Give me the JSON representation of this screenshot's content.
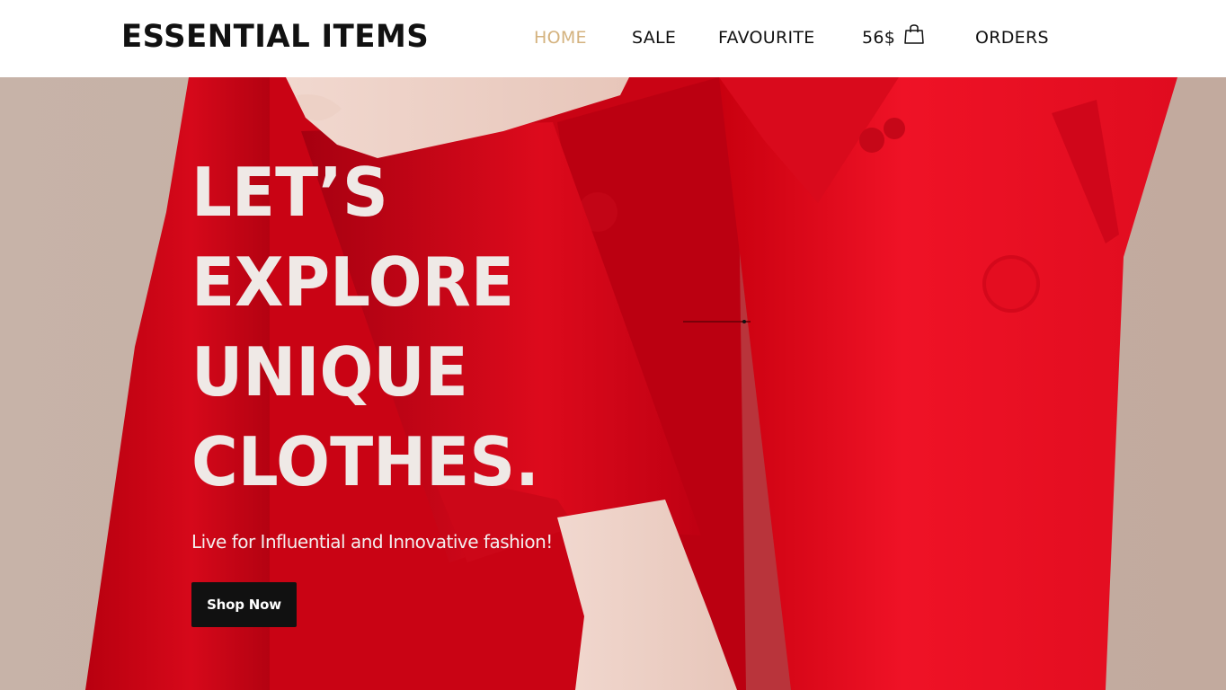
{
  "header": {
    "brand": "ESSENTIAL ITEMS",
    "nav": {
      "home": "HOME",
      "sale": "SALE",
      "favourite": "FAVOURITE",
      "cart_total": "56$",
      "orders": "ORDERS"
    },
    "cart_icon": "shopping-bag-icon",
    "active_color": "#d4b27e"
  },
  "hero": {
    "heading_lines": [
      "LET’S",
      "EXPLORE",
      "UNIQUE",
      "CLOTHES."
    ],
    "subtitle": "Live for Influential and Innovative fashion!",
    "cta_label": "Shop Now",
    "background_image": "person in red suit jacket"
  },
  "colors": {
    "heading_text": "#efe9e6",
    "button_bg": "#111111",
    "jacket_red": "#e0101e",
    "backdrop": "#c4ada1"
  }
}
